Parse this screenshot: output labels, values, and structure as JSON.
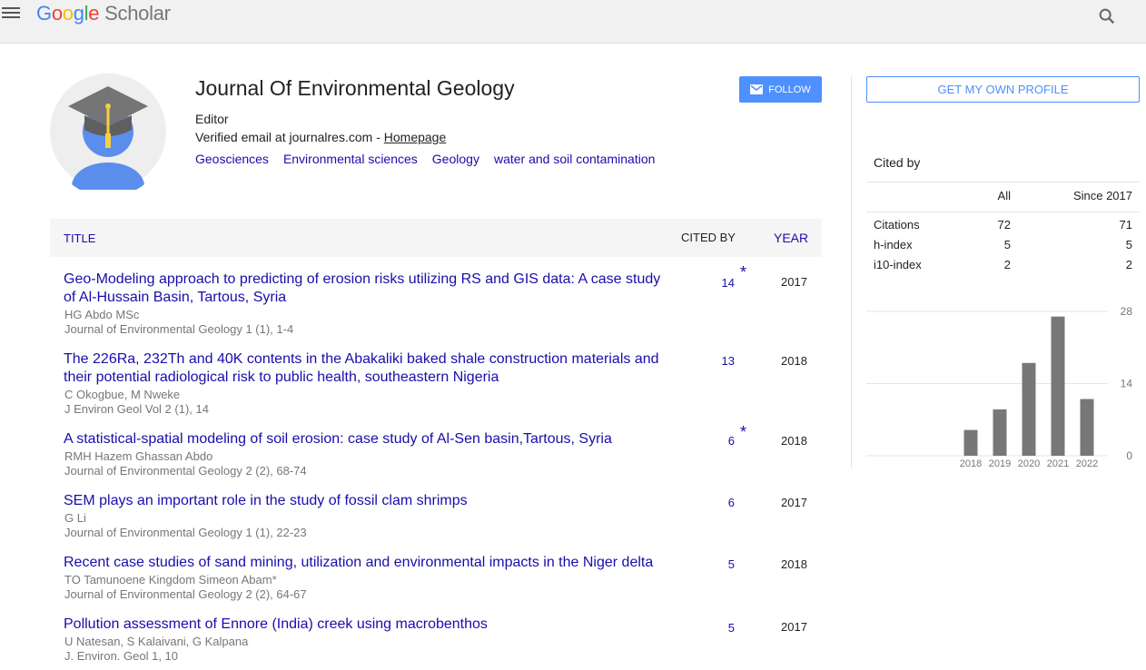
{
  "header": {
    "logo_letters": [
      "G",
      "o",
      "o",
      "g",
      "l",
      "e"
    ],
    "logo_suffix": "Scholar",
    "icons": {
      "menu": "hamburger-menu-icon",
      "search": "search-icon"
    }
  },
  "profile": {
    "name": "Journal Of Environmental Geology",
    "affiliation": "Editor",
    "email_text": "Verified email at journalres.com - ",
    "homepage_label": "Homepage",
    "interests": [
      "Geosciences",
      "Environmental sciences",
      "Geology",
      "water and soil contamination"
    ],
    "follow_label": "FOLLOW"
  },
  "table": {
    "headers": {
      "title": "TITLE",
      "cited_by": "CITED BY",
      "year": "YEAR"
    },
    "rows": [
      {
        "title": "Geo-Modeling approach to predicting of erosion risks utilizing RS and GIS data: A case study of Al-Hussain Basin, Tartous, Syria",
        "authors": "HG Abdo MSc",
        "venue": "Journal of Environmental Geology 1 (1), 1-4",
        "cited": "14",
        "star": "*",
        "year": "2017"
      },
      {
        "title": "The 226Ra, 232Th and 40K contents in the Abakaliki baked shale construction materials and their potential radiological risk to public health, southeastern Nigeria",
        "authors": "C Okogbue, M Nweke",
        "venue": "J Environ Geol Vol 2 (1), 14",
        "cited": "13",
        "star": "",
        "year": "2018"
      },
      {
        "title": "A statistical-spatial modeling of soil erosion: case study of Al-Sen basin,Tartous, Syria",
        "authors": "RMH Hazem Ghassan Abdo",
        "venue": "Journal of Environmental Geology 2 (2), 68-74",
        "cited": "6",
        "star": "*",
        "year": "2018"
      },
      {
        "title": "SEM plays an important role in the study of fossil clam shrimps",
        "authors": "G Li",
        "venue": "Journal of Environmental Geology 1 (1), 22-23",
        "cited": "6",
        "star": "",
        "year": "2017"
      },
      {
        "title": "Recent case studies of sand mining, utilization and environmental impacts in the Niger delta",
        "authors": "TO Tamunoene Kingdom Simeon Abam*",
        "venue": "Journal of Environmental Geology 2 (2), 64-67",
        "cited": "5",
        "star": "",
        "year": "2018"
      },
      {
        "title": "Pollution assessment of Ennore (India) creek using macrobenthos",
        "authors": "U Natesan, S Kalaivani, G Kalpana",
        "venue": "J. Environ. Geol 1, 10",
        "cited": "5",
        "star": "",
        "year": "2017"
      }
    ]
  },
  "sidebar": {
    "get_profile_label": "GET MY OWN PROFILE",
    "cited_by_title": "Cited by",
    "stats_headers": {
      "all": "All",
      "since": "Since 2017"
    },
    "stats": [
      {
        "label": "Citations",
        "all": "72",
        "since": "71"
      },
      {
        "label": "h-index",
        "all": "5",
        "since": "5"
      },
      {
        "label": "i10-index",
        "all": "2",
        "since": "2"
      }
    ]
  },
  "chart_data": {
    "type": "bar",
    "categories": [
      "2018",
      "2019",
      "2020",
      "2021",
      "2022"
    ],
    "values": [
      5,
      9,
      18,
      27,
      11
    ],
    "ylim": [
      0,
      28
    ],
    "yticks": [
      "0",
      "14",
      "28"
    ],
    "bar_color": "#777777",
    "grid": true
  },
  "colors": {
    "link": "#1a0dab",
    "accent": "#4d90fe",
    "muted": "#777777"
  }
}
